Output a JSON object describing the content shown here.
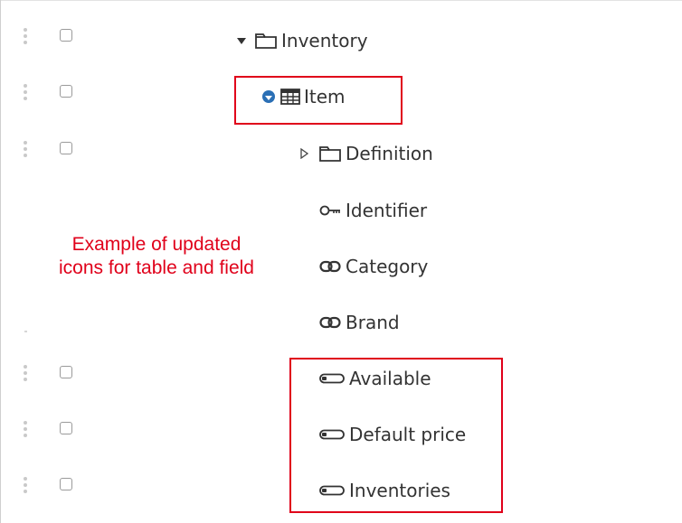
{
  "tree": {
    "rows": [
      {
        "label": "Inventory",
        "icon": "folder-icon",
        "toggle": "caret-down-icon"
      },
      {
        "label": "Item",
        "icon": "table-icon",
        "toggle": "circle-caret-down-icon"
      },
      {
        "label": "Definition",
        "icon": "folder-icon",
        "toggle": "caret-right-outline-icon"
      },
      {
        "label": "Identifier",
        "icon": "key-icon"
      },
      {
        "label": "Category",
        "icon": "link-icon"
      },
      {
        "label": "Brand",
        "icon": "link-icon"
      },
      {
        "label": "Available",
        "icon": "field-icon"
      },
      {
        "label": "Default price",
        "icon": "field-icon"
      },
      {
        "label": "Inventories",
        "icon": "field-icon"
      }
    ]
  },
  "annotation": {
    "line1": "Example of updated",
    "line2": "icons for table and field",
    "color": "#e0001a"
  },
  "colors": {
    "accent": "#2a6fb5",
    "highlight": "#e0001a"
  }
}
